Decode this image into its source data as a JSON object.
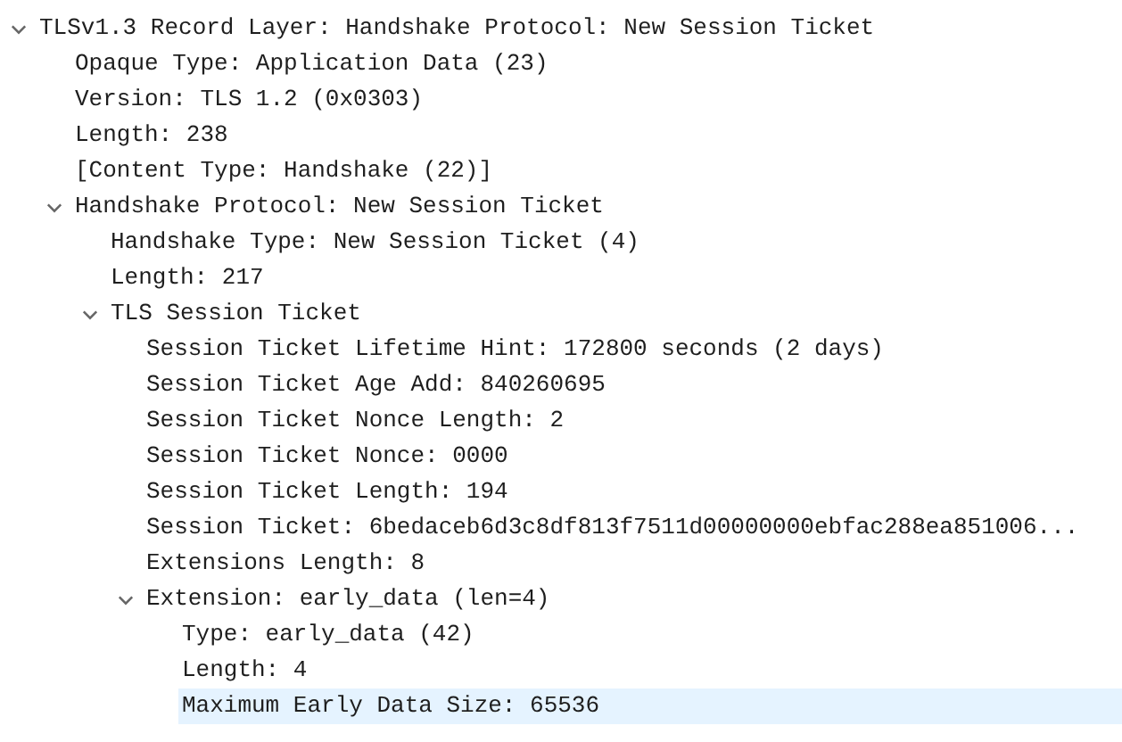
{
  "tree": [
    {
      "label": "TLSv1.3 Record Layer: Handshake Protocol: New Session Ticket",
      "selected": false,
      "expanded": true,
      "children": [
        {
          "label": "Opaque Type: Application Data (23)",
          "selected": false
        },
        {
          "label": "Version: TLS 1.2 (0x0303)",
          "selected": false
        },
        {
          "label": "Length: 238",
          "selected": false
        },
        {
          "label": "[Content Type: Handshake (22)]",
          "selected": false
        },
        {
          "label": "Handshake Protocol: New Session Ticket",
          "selected": false,
          "expanded": true,
          "children": [
            {
              "label": "Handshake Type: New Session Ticket (4)",
              "selected": false
            },
            {
              "label": "Length: 217",
              "selected": false
            },
            {
              "label": "TLS Session Ticket",
              "selected": false,
              "expanded": true,
              "children": [
                {
                  "label": "Session Ticket Lifetime Hint: 172800 seconds (2 days)",
                  "selected": false
                },
                {
                  "label": "Session Ticket Age Add: 840260695",
                  "selected": false
                },
                {
                  "label": "Session Ticket Nonce Length: 2",
                  "selected": false
                },
                {
                  "label": "Session Ticket Nonce: 0000",
                  "selected": false
                },
                {
                  "label": "Session Ticket Length: 194",
                  "selected": false
                },
                {
                  "label": "Session Ticket: 6bedaceb6d3c8df813f7511d00000000ebfac288ea851006...",
                  "selected": false
                },
                {
                  "label": "Extensions Length: 8",
                  "selected": false
                },
                {
                  "label": "Extension: early_data (len=4)",
                  "selected": false,
                  "expanded": true,
                  "children": [
                    {
                      "label": "Type: early_data (42)",
                      "selected": false
                    },
                    {
                      "label": "Length: 4",
                      "selected": false
                    },
                    {
                      "label": "Maximum Early Data Size: 65536",
                      "selected": true
                    }
                  ]
                }
              ]
            }
          ]
        }
      ]
    }
  ]
}
